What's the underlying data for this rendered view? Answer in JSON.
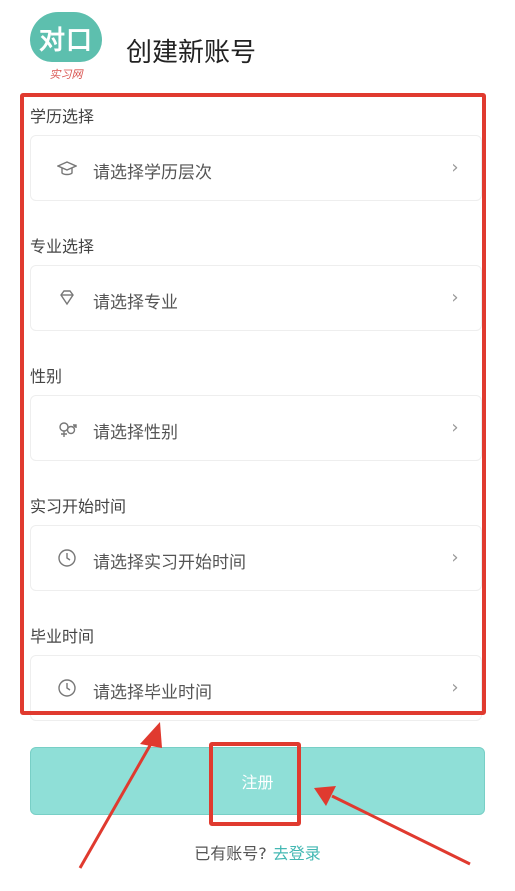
{
  "header": {
    "logo_main": "对口",
    "logo_sub": "实习网",
    "title": "创建新账号"
  },
  "form": {
    "sections": [
      {
        "label": "学历选择",
        "placeholder": "请选择学历层次",
        "icon": "graduation-cap-icon"
      },
      {
        "label": "专业选择",
        "placeholder": "请选择专业",
        "icon": "diamond-icon"
      },
      {
        "label": "性别",
        "placeholder": "请选择性别",
        "icon": "gender-icon"
      },
      {
        "label": "实习开始时间",
        "placeholder": "请选择实习开始时间",
        "icon": "clock-icon"
      },
      {
        "label": "毕业时间",
        "placeholder": "请选择毕业时间",
        "icon": "clock-icon"
      }
    ]
  },
  "actions": {
    "register_label": "注册",
    "have_account_text": "已有账号?",
    "login_link": "去登录"
  },
  "colors": {
    "accent": "#44b8b3",
    "button_bg": "#8fdfd7",
    "annotation_red": "#e03a2f"
  }
}
